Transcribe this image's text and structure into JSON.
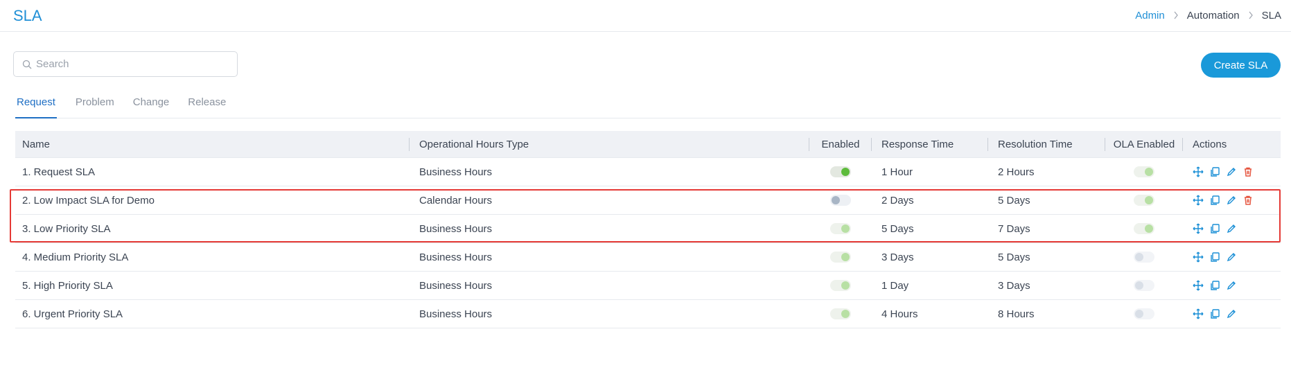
{
  "page": {
    "title": "SLA"
  },
  "breadcrumb": {
    "items": [
      "Admin",
      "Automation",
      "SLA"
    ]
  },
  "search": {
    "placeholder": "Search",
    "value": ""
  },
  "toolbar": {
    "create_label": "Create SLA"
  },
  "tabs": [
    {
      "label": "Request",
      "active": true
    },
    {
      "label": "Problem",
      "active": false
    },
    {
      "label": "Change",
      "active": false
    },
    {
      "label": "Release",
      "active": false
    }
  ],
  "table": {
    "headers": [
      "Name",
      "Operational Hours Type",
      "Enabled",
      "Response Time",
      "Resolution Time",
      "OLA Enabled",
      "Actions"
    ],
    "rows": [
      {
        "name": "1. Request SLA",
        "ops": "Business Hours",
        "enabled": "on-strong",
        "response": "1 Hour",
        "resolution": "2 Hours",
        "ola": "on-light",
        "deletable": true
      },
      {
        "name": "2. Low Impact SLA for Demo",
        "ops": "Calendar Hours",
        "enabled": "off",
        "response": "2 Days",
        "resolution": "5 Days",
        "ola": "on-light",
        "deletable": true
      },
      {
        "name": "3. Low Priority SLA",
        "ops": "Business Hours",
        "enabled": "on-light",
        "response": "5 Days",
        "resolution": "7 Days",
        "ola": "on-light",
        "deletable": false
      },
      {
        "name": "4. Medium Priority SLA",
        "ops": "Business Hours",
        "enabled": "on-light",
        "response": "3 Days",
        "resolution": "5 Days",
        "ola": "off-light",
        "deletable": false
      },
      {
        "name": "5. High Priority SLA",
        "ops": "Business Hours",
        "enabled": "on-light",
        "response": "1 Day",
        "resolution": "3 Days",
        "ola": "off-light",
        "deletable": false
      },
      {
        "name": "6. Urgent Priority SLA",
        "ops": "Business Hours",
        "enabled": "on-light",
        "response": "4 Hours",
        "resolution": "8 Hours",
        "ola": "off-light",
        "deletable": false
      }
    ]
  },
  "colors": {
    "accent": "#1a99d9",
    "highlight": "#e53935",
    "delete": "#e5533d"
  },
  "icons": {
    "search": "search-icon",
    "breadcrumb_separator": "chevron-right-icon",
    "move": "move-icon",
    "copy": "copy-icon",
    "edit": "pencil-icon",
    "delete": "trash-icon"
  }
}
